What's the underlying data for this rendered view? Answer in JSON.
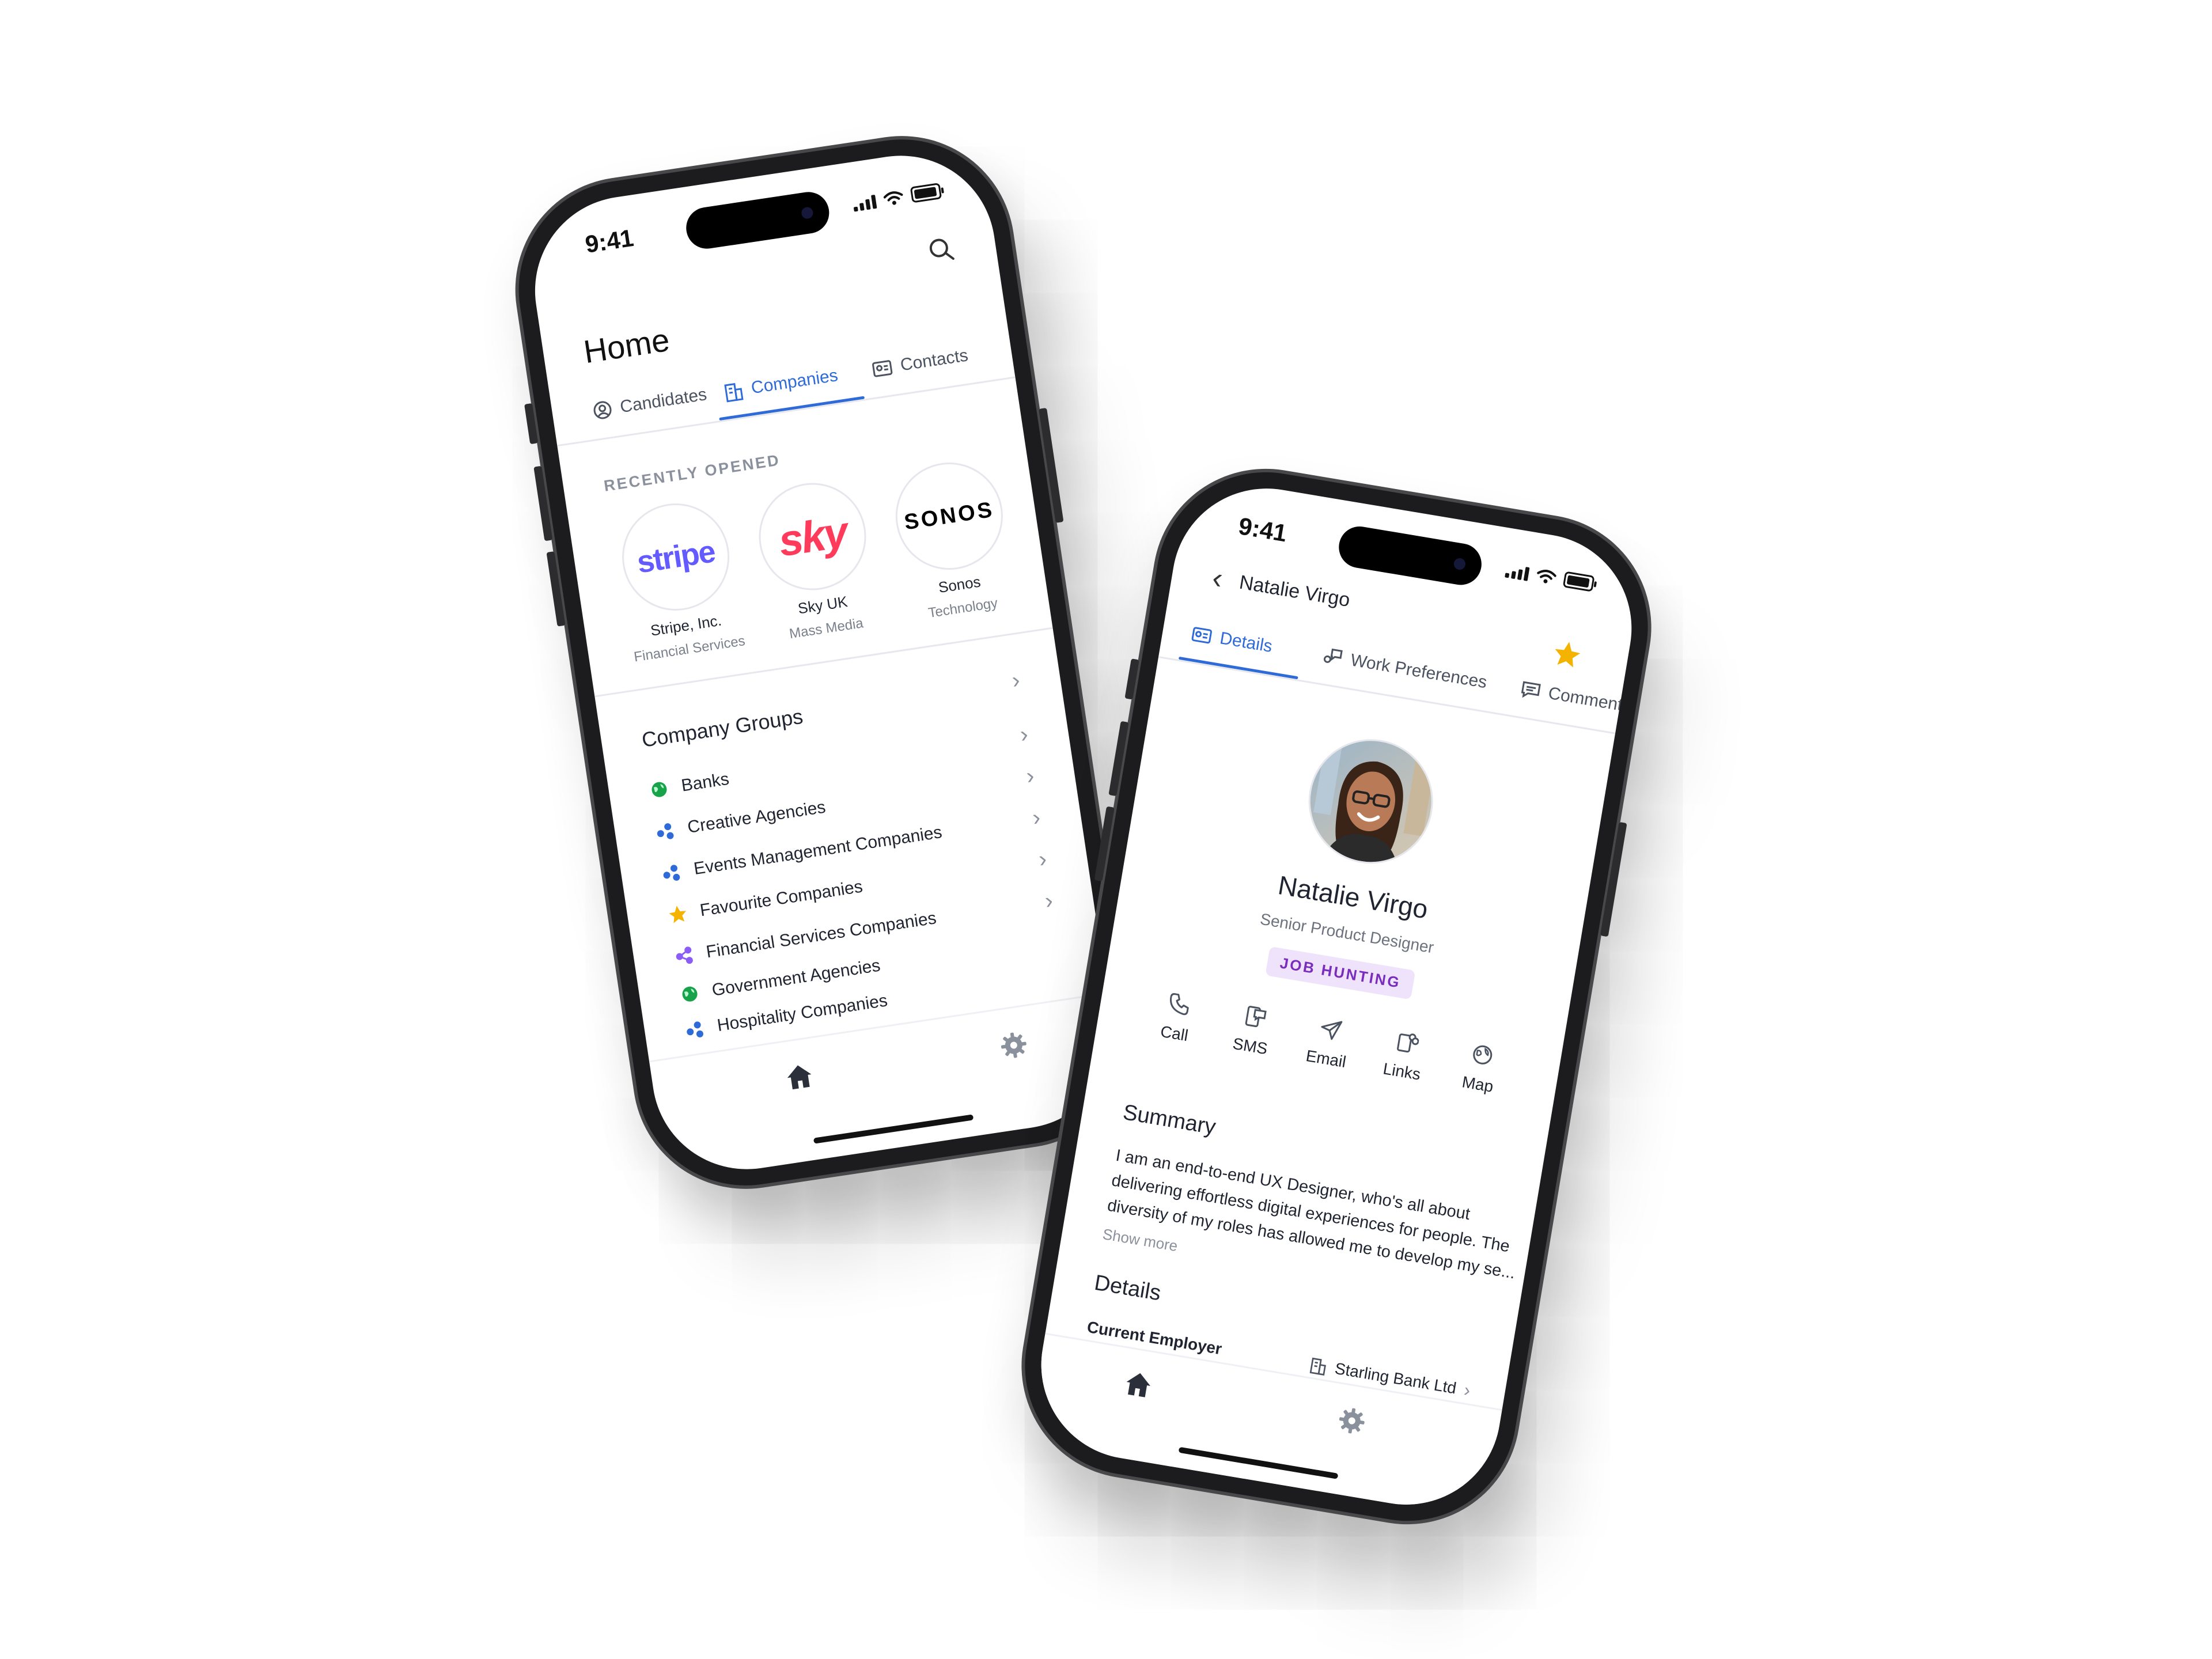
{
  "phone_home": {
    "status_time": "9:41",
    "title": "Home",
    "tabs": [
      {
        "label": "Candidates",
        "icon": "person-icon",
        "active": false
      },
      {
        "label": "Companies",
        "icon": "building-icon",
        "active": true
      },
      {
        "label": "Contacts",
        "icon": "contact-card-icon",
        "active": false
      }
    ],
    "recent_label": "RECENTLY OPENED",
    "recent": [
      {
        "logo_text": "stripe",
        "name": "Stripe, Inc.",
        "industry": "Financial Services",
        "color": "#635bff"
      },
      {
        "logo_text": "sky",
        "name": "Sky UK",
        "industry": "Mass Media",
        "color": "#ff3b5c"
      },
      {
        "logo_text": "SONOS",
        "name": "Sonos",
        "industry": "Technology",
        "color": "#000000"
      }
    ],
    "groups_title": "Company Groups",
    "groups": [
      {
        "label": "Banks",
        "icon": "globe-icon",
        "color": "#16a34a"
      },
      {
        "label": "Creative Agencies",
        "icon": "cluster-icon",
        "color": "#2f6bd8"
      },
      {
        "label": "Events Management Companies",
        "icon": "cluster-icon",
        "color": "#2f6bd8"
      },
      {
        "label": "Favourite Companies",
        "icon": "star-icon",
        "color": "#f5b301"
      },
      {
        "label": "Financial Services Companies",
        "icon": "share-icon",
        "color": "#8b5cf6"
      },
      {
        "label": "Government Agencies",
        "icon": "globe-icon",
        "color": "#16a34a"
      },
      {
        "label": "Hospitality Companies",
        "icon": "cluster-icon",
        "color": "#2f6bd8"
      }
    ],
    "nav": {
      "home_icon": "home-icon",
      "settings_icon": "gear-icon"
    }
  },
  "phone_profile": {
    "status_time": "9:41",
    "back_icon": "chevron-left-icon",
    "header_name": "Natalie Virgo",
    "tabs": [
      {
        "label": "Details",
        "icon": "id-card-icon",
        "active": true
      },
      {
        "label": "Work Preferences",
        "icon": "preferences-icon",
        "active": false
      },
      {
        "label": "Comments",
        "icon": "comment-icon",
        "active": false
      }
    ],
    "favourite_icon": "star-icon",
    "name": "Natalie Virgo",
    "role": "Senior Product Designer",
    "badge": "JOB HUNTING",
    "actions": [
      {
        "label": "Call",
        "icon": "phone-icon"
      },
      {
        "label": "SMS",
        "icon": "sms-icon"
      },
      {
        "label": "Email",
        "icon": "send-icon"
      },
      {
        "label": "Links",
        "icon": "link-icon"
      },
      {
        "label": "Map",
        "icon": "globe-map-icon"
      }
    ],
    "summary_title": "Summary",
    "summary_lines": [
      "I am an end-to-end UX Designer, who's all about",
      "delivering effortless digital experiences for people. The",
      "diversity of my roles has allowed me to develop my se..."
    ],
    "show_more": "Show more",
    "details_title": "Details",
    "employer_label": "Current Employer",
    "employer_value": "Starling Bank Ltd",
    "nav": {
      "home_icon": "home-icon",
      "settings_icon": "gear-icon"
    }
  },
  "colors": {
    "accent": "#2f6bd8",
    "badge_bg": "#efe2fb",
    "badge_text": "#7a2dbb",
    "star": "#f5b301"
  }
}
